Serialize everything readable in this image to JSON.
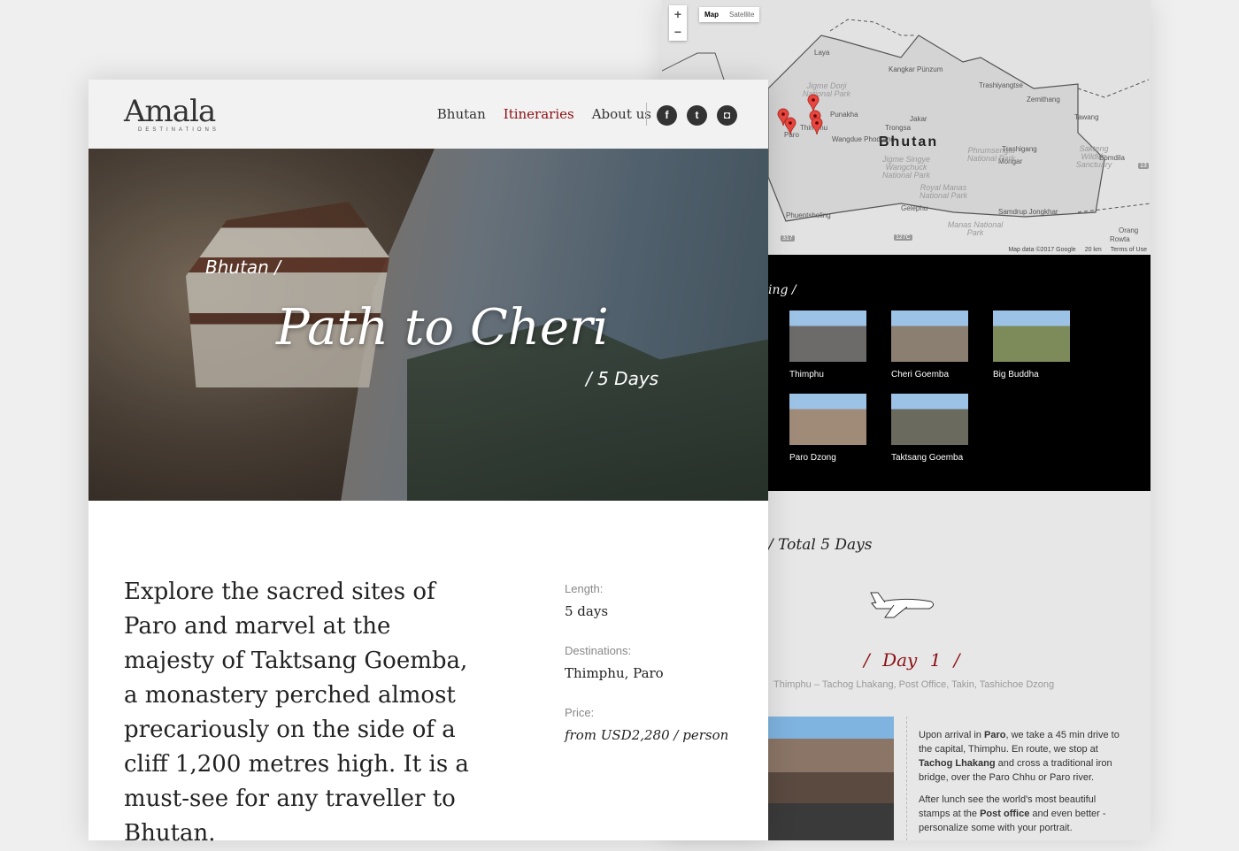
{
  "map": {
    "zoom_in": "+",
    "zoom_out": "−",
    "types": [
      "Map",
      "Satellite"
    ],
    "country": "Bhutan",
    "labels": [
      {
        "t": "Laya",
        "c": "city"
      },
      {
        "t": "Kangkar Pünzum",
        "c": "city"
      },
      {
        "t": "Trashiyangtse",
        "c": "city"
      },
      {
        "t": "Zemithang",
        "c": "city"
      },
      {
        "t": "Tawang",
        "c": "city"
      },
      {
        "t": "Punakha",
        "c": "city"
      },
      {
        "t": "Jakar",
        "c": "city"
      },
      {
        "t": "Trongsa",
        "c": "city"
      },
      {
        "t": "Thimphu",
        "c": "city"
      },
      {
        "t": "Paro",
        "c": "city"
      },
      {
        "t": "Wangdue Phodrang",
        "c": "city"
      },
      {
        "t": "Trashigang",
        "c": "city"
      },
      {
        "t": "Mongar",
        "c": "city"
      },
      {
        "t": "Bomdila",
        "c": "city"
      },
      {
        "t": "Phuentsholing",
        "c": "city"
      },
      {
        "t": "Gelephu",
        "c": "city"
      },
      {
        "t": "Samdrup Jongkhar",
        "c": "city"
      },
      {
        "t": "Orang",
        "c": "city"
      },
      {
        "t": "Rowta",
        "c": "city"
      },
      {
        "t": "Jigme Dorji National Park",
        "c": "park"
      },
      {
        "t": "Jigme Singye Wangchuck National Park",
        "c": "park"
      },
      {
        "t": "Phrumsengla National Park",
        "c": "park"
      },
      {
        "t": "Sakteng Wildlife Sanctuary",
        "c": "park"
      },
      {
        "t": "Royal Manas National Park",
        "c": "park"
      },
      {
        "t": "Manas National Park",
        "c": "park"
      }
    ],
    "road_shields": [
      "317",
      "127C",
      "13"
    ],
    "attribution": "Map data ©2017 Google",
    "scale": "20 km",
    "terms": "Terms of Use",
    "pin_color": "#e8473f"
  },
  "gallery": {
    "title": "ing /",
    "items": [
      {
        "caption": "Thimphu",
        "tone": "#6d6a6a"
      },
      {
        "caption": "Cheri Goemba",
        "tone": "#8a7f70"
      },
      {
        "caption": "Big Buddha",
        "tone": "#7d8a5a"
      },
      {
        "caption": "Paro Dzong",
        "tone": "#a08a78"
      },
      {
        "caption": "Taktsang Goemba",
        "tone": "#6a6a5e"
      }
    ]
  },
  "itinerary": {
    "total": "/ Total 5 Days",
    "day_title": "/  Day 1  /",
    "day_sub": "Thimphu – Tachog Lhakang, Post Office, Takin, Tashichoe Dzong",
    "paragraphs": [
      [
        {
          "t": "Upon arrival in "
        },
        {
          "t": "Paro",
          "b": true
        },
        {
          "t": ", we take a 45 min drive to the capital, Thimphu. En route, we stop at "
        },
        {
          "t": "Tachog Lhakang",
          "b": true
        },
        {
          "t": " and cross a traditional iron bridge, over the Paro Chhu or Paro river."
        }
      ],
      [
        {
          "t": "After lunch see the world's most beautiful stamps at the "
        },
        {
          "t": "Post office",
          "b": true
        },
        {
          "t": " and even better - personalize some with your portrait."
        }
      ]
    ]
  },
  "header": {
    "logo": "Amala",
    "logo_sub": "DESTINATIONS",
    "nav": [
      {
        "label": "Bhutan",
        "active": false
      },
      {
        "label": "Itineraries",
        "active": true
      },
      {
        "label": "About us",
        "active": false
      }
    ],
    "social": [
      {
        "icon": "facebook-icon",
        "glyph": "f"
      },
      {
        "icon": "twitter-icon",
        "glyph": "t"
      },
      {
        "icon": "instagram-icon",
        "glyph": "◘"
      }
    ],
    "accent": "#8b0f14"
  },
  "hero": {
    "breadcrumb": "Bhutan  /",
    "title": "Path to Cheri",
    "days": "/ 5 Days"
  },
  "intro": "Explore the sacred sites of Paro and marvel at the majesty of Taktsang Goemba, a monastery perched almost precariously on the side of a cliff 1,200 metres high. It is a must-see for any traveller to Bhutan.",
  "facts": [
    {
      "label": "Length:",
      "value": "5 days"
    },
    {
      "label": "Destinations:",
      "value": "Thimphu, Paro"
    },
    {
      "label": "Price:",
      "value": "from USD2,280 / person"
    }
  ]
}
